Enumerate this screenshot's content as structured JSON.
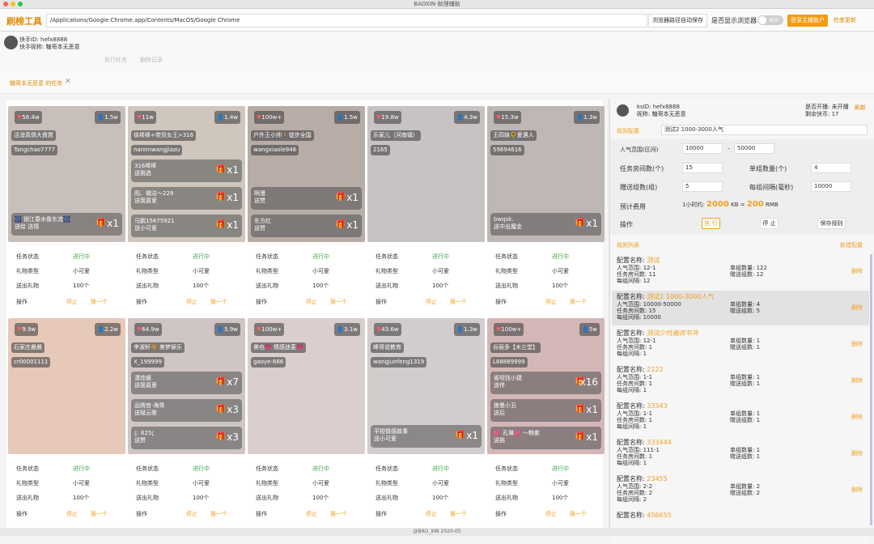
{
  "app": {
    "window_title": "BAOXIN-助理辅助",
    "brand": "刷榜工具",
    "path": "/Applications/Google Chrome.app/Contents/MacOS/Google Chrome",
    "autosave_label": "浏览器路径自动保存",
    "show_browser_label": "是否显示浏览器:",
    "toggle_label": "关闭",
    "login_label": "登录主播账户",
    "update_label": "检查更新"
  },
  "user": {
    "id_line": "快手ID: hefx8888",
    "nick_line": "快手昵称: 糖哥本无恶意",
    "nav1": "执行任务",
    "nav2": "删除记录"
  },
  "tab": {
    "label": "糖哥本无恶意 的任务",
    "close": "✕"
  },
  "info_labels": {
    "status": "任务状态",
    "gift_type": "礼物类型",
    "sent": "送出礼物",
    "op": "操作",
    "stop": "停止",
    "next": "换一个"
  },
  "cards": [
    {
      "likes": "56.4w",
      "viewers": "1.5w",
      "tags": [
        "活潑真情大資質",
        "Tangchao7777"
      ],
      "gifts": [
        {
          "t": "🎆 销江春水像东流🎆",
          "s": "送给 送情",
          "q": "x1"
        }
      ],
      "status": "进行中",
      "gtype": "小可爱",
      "sent": "100个",
      "bg": "#c9bfba"
    },
    {
      "likes": "11w",
      "viewers": "1.4w",
      "tags": [
        "徐棒棒+带货女王>316",
        "nannnwangjiazu"
      ],
      "gifts": [
        {
          "t": "316棒棒",
          "s": "送挑选",
          "q": "x1"
        },
        {
          "t": "阳、微洁～229",
          "s": "送我喜爱",
          "q": "x1"
        },
        {
          "t": "马鹏15675921",
          "s": "送小可爱",
          "q": "x1"
        }
      ],
      "status": "进行中",
      "gtype": "小可爱",
      "sent": "100个",
      "bg": "#cfc6bd"
    },
    {
      "likes": "100w+",
      "viewers": "1.5w",
      "tags": [
        "户外王小帅🚶徒步全国",
        "wangxiaole946"
      ],
      "gifts": [
        {
          "t": "啊漫",
          "s": "送赞",
          "q": "x1"
        },
        {
          "t": "东方红",
          "s": "送赞",
          "q": "x1"
        }
      ],
      "status": "进行中",
      "gtype": "小可爱",
      "sent": "100个",
      "bg": "#b7aca6"
    },
    {
      "likes": "19.8w",
      "viewers": "4.3w",
      "tags": [
        "乐家儿（河南镇）",
        "2165"
      ],
      "gifts": [],
      "status": "进行中",
      "gtype": "小可爱",
      "sent": "100个",
      "bg": "#c7c3c2"
    },
    {
      "likes": "15.3w",
      "viewers": "1.3w",
      "tags": [
        "王四妹🌻爱遇人",
        "59694616"
      ],
      "gifts": [
        {
          "t": "bwqsk.",
          "s": "送中出魔金",
          "q": "x1"
        }
      ],
      "status": "进行中",
      "gtype": "小可爱",
      "sent": "100个",
      "bg": "#bfb7b5"
    },
    {
      "likes": "9.9w",
      "viewers": "2.2w",
      "tags": [
        "石家庄晨晨",
        "cr00001111"
      ],
      "gifts": [],
      "status": "进行中",
      "gtype": "小可爱",
      "sent": "100个",
      "bg": "#e7c9b9"
    },
    {
      "likes": "64.9w",
      "viewers": "5.9w",
      "tags": [
        "李淑轩🔆 美梦娱乐",
        "X_199999"
      ],
      "gifts": [
        {
          "t": "潇佳缓",
          "s": "送我喜爱",
          "q": "x7"
        },
        {
          "t": "品牌官-海哥",
          "s": "送赋云歌",
          "q": "x3"
        },
        {
          "t": "ꦿ 625 ꦿ",
          "s": "送赞",
          "q": "x3"
        }
      ],
      "status": "进行中",
      "gtype": "小可爱",
      "sent": "100个",
      "bg": "#cfc5c5"
    },
    {
      "likes": "100w+",
      "viewers": "3.1w",
      "tags": [
        "美也💗 情感迷麦💗",
        "gaoye-666"
      ],
      "gifts": [],
      "status": "进行中",
      "gtype": "小可爱",
      "sent": "100个",
      "bg": "#dbcfcd"
    },
    {
      "likes": "43.6w",
      "viewers": "1.3w",
      "tags": [
        "峰哥说教育",
        "wangjunfeng1319"
      ],
      "gifts": [
        {
          "t": "平短情感故事",
          "s": "送小可爱",
          "q": "x1"
        }
      ],
      "status": "进行中",
      "gtype": "小可爱",
      "sent": "100个",
      "bg": "#d2cdcc"
    },
    {
      "likes": "100w+",
      "viewers": "5w",
      "tags": [
        "谷丽多【木兰堂】",
        "L88889999"
      ],
      "gifts": [
        {
          "t": "雀啦找小捷",
          "s": "送伴",
          "q": "x16"
        },
        {
          "t": "狼墨小丑",
          "s": "送后",
          "q": "x1"
        },
        {
          "t": "💕 孔琳💕 ～畅紫",
          "s": "送挑",
          "q": "x1"
        }
      ],
      "status": "进行中",
      "gtype": "小可爱",
      "sent": "100个",
      "bg": "#d3b7b7"
    }
  ],
  "panel": {
    "ks_id": "ksID: hefx8888",
    "nick": "昵称: 糖哥本无恶意",
    "live": "是否开播: 未开播",
    "remain": "剩余快币: 17",
    "refresh": "刷新",
    "rule_cfg_label": "规则配置",
    "rule_cfg_value": "测试2 1000-3000人气",
    "pop_label": "人气范围(区间)",
    "pop_min": "10000",
    "pop_max": "50000",
    "dash": "-",
    "room_label": "任务房间数(个)",
    "room_val": "15",
    "single_label": "单组数量(个)",
    "single_val": "4",
    "group_label": "赠送组数(组)",
    "group_val": "5",
    "interval_label": "每组间隔(毫秒)",
    "interval_val": "10000",
    "cost_label": "预计费用",
    "cost_prefix": "1小时约:",
    "cost_kb": "2000",
    "cost_kb_unit": "KB =",
    "cost_rmb": "200",
    "cost_rmb_unit": "RMB",
    "op_label": "操作",
    "run_label": "执 行",
    "stop_label": "停 止",
    "save_label": "保存规则",
    "list_label": "规则列表",
    "new_label": "新建配置",
    "field_name": "配置名称:",
    "f_pop": "人气范围:",
    "f_room": "任务房间数:",
    "f_interval": "每组间隔:",
    "f_single": "单组数量:",
    "f_group": "赠送组数:",
    "delete": "删除",
    "rules": [
      {
        "name": "测试",
        "pop": "12-1",
        "room": "11",
        "interval": "12",
        "single": "122",
        "group": "12"
      },
      {
        "name": "测试2 1000-3000人气",
        "pop": "10000-50000",
        "room": "15",
        "interval": "10000",
        "single": "4",
        "group": "5"
      },
      {
        "name": "测试少时遍谛书冲",
        "pop": "12-1",
        "room": "1",
        "interval": "1",
        "single": "1",
        "group": "1"
      },
      {
        "name": "2122",
        "pop": "1-1",
        "room": "1",
        "interval": "1",
        "single": "1",
        "group": "1"
      },
      {
        "name": "33343",
        "pop": "1-1",
        "room": "1",
        "interval": "1",
        "single": "1",
        "group": "1"
      },
      {
        "name": "333444",
        "pop": "111-1",
        "room": "1",
        "interval": "1",
        "single": "1",
        "group": "1"
      },
      {
        "name": "23455",
        "pop": "2-2",
        "room": "2",
        "interval": "2",
        "single": "2",
        "group": "2"
      },
      {
        "name": "456655"
      }
    ]
  },
  "footer": "@BAO_XIN 2020-05",
  "colors": {
    "accent": "#f39c12",
    "brand": "#e08a00",
    "green": "#3aa64a"
  }
}
